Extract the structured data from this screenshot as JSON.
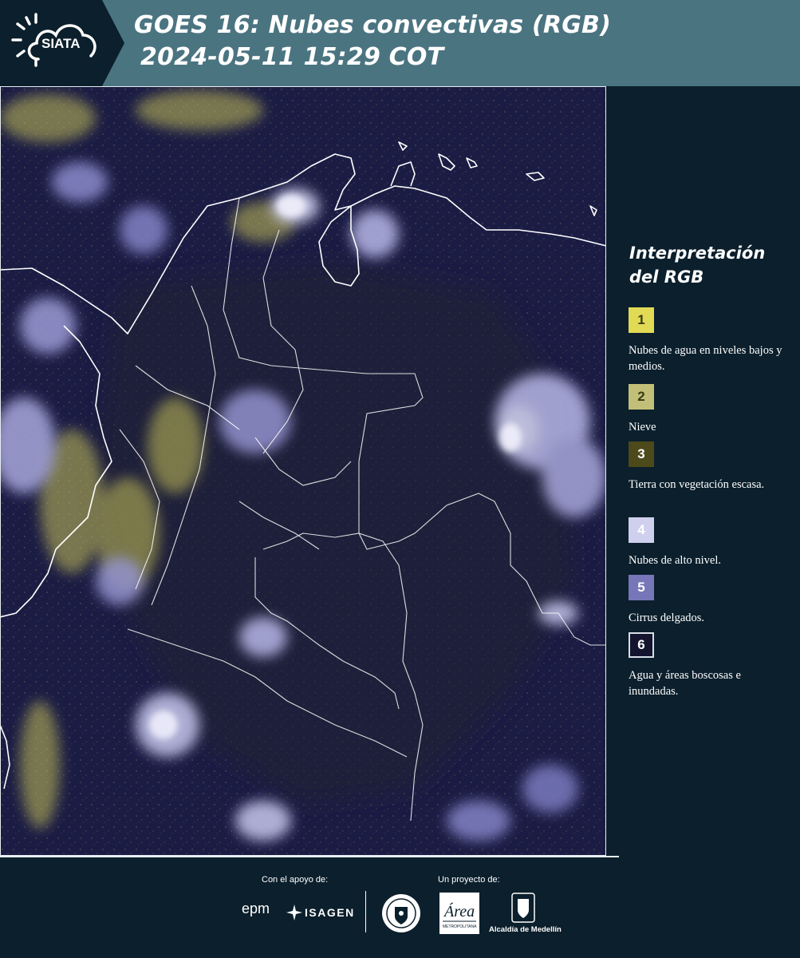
{
  "header": {
    "logo_text": "SIATA",
    "title_line1": "GOES 16: Nubes convectivas (RGB)",
    "title_line2": "2024-05-11 15:29 COT",
    "background_color": "#4b7481"
  },
  "map": {
    "icon": "satellite-imagery",
    "background_color": "#1b1c44",
    "border_color": "#ffffff"
  },
  "legend": {
    "title": "Interpretación del RGB",
    "items": [
      {
        "number": "1",
        "label": "Nubes de agua en niveles bajos y medios.",
        "color": "#e1da54",
        "number_color": "#3a3a12"
      },
      {
        "number": "2",
        "label": "Nieve",
        "color": "#c2bf78",
        "number_color": "#3a3a12"
      },
      {
        "number": "3",
        "label": "Tierra con vegetación escasa.",
        "color": "#4c4a1b",
        "number_color": "#ffffff"
      },
      {
        "number": "4",
        "label": "Nubes de alto nivel.",
        "color": "#cfcfee",
        "number_color": "#ffffff"
      },
      {
        "number": "5",
        "label": "Cirrus delgados.",
        "color": "#7676b8",
        "number_color": "#ffffff"
      },
      {
        "number": "6",
        "label": "Agua y áreas boscosas e inundadas.",
        "color": "#14142e",
        "number_color": "#ffffff"
      }
    ]
  },
  "footer": {
    "support_label": "Con el apoyo de:",
    "project_label": "Un proyecto de:",
    "sponsors": [
      "epm",
      "ISAGEN"
    ],
    "partners": [
      "Alcaldía de Medellín"
    ],
    "area_logo_text": "Área",
    "area_subtext": "METROPOLITANA",
    "background_color": "#0b1f2c"
  }
}
